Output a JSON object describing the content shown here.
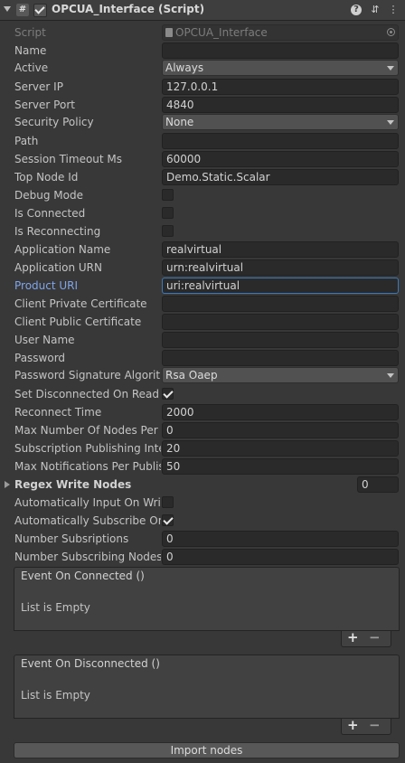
{
  "header": {
    "icon_glyph": "#",
    "title": "OPCUA_Interface (Script)",
    "enabled": true,
    "help_glyph": "?",
    "settings_glyph": "⇵",
    "menu_glyph": "⋮"
  },
  "fields": {
    "script": {
      "label": "Script",
      "value": "OPCUA_Interface"
    },
    "name": {
      "label": "Name",
      "value": ""
    },
    "active": {
      "label": "Active",
      "value": "Always"
    },
    "server_ip": {
      "label": "Server IP",
      "value": "127.0.0.1"
    },
    "server_port": {
      "label": "Server Port",
      "value": "4840"
    },
    "security_policy": {
      "label": "Security Policy",
      "value": "None"
    },
    "path": {
      "label": "Path",
      "value": ""
    },
    "session_timeout": {
      "label": "Session Timeout Ms",
      "value": "60000"
    },
    "top_node_id": {
      "label": "Top Node Id",
      "value": "Demo.Static.Scalar"
    },
    "debug_mode": {
      "label": "Debug Mode",
      "checked": false
    },
    "is_connected": {
      "label": "Is Connected",
      "checked": false
    },
    "is_reconnecting": {
      "label": "Is Reconnecting",
      "checked": false
    },
    "application_name": {
      "label": "Application Name",
      "value": "realvirtual"
    },
    "application_urn": {
      "label": "Application URN",
      "value": "urn:realvirtual"
    },
    "product_uri": {
      "label": "Product URI",
      "value": "uri:realvirtual"
    },
    "client_private_cert": {
      "label": "Client Private Certificate",
      "value": ""
    },
    "client_public_cert": {
      "label": "Client Public Certificate",
      "value": ""
    },
    "user_name": {
      "label": "User Name",
      "value": ""
    },
    "password": {
      "label": "Password",
      "value": ""
    },
    "password_sig_algorithm": {
      "label": "Password Signature Algorithm",
      "value": "Rsa Oaep"
    },
    "set_disconnected_on_read_error": {
      "label": "Set Disconnected On Read Error",
      "checked": true
    },
    "reconnect_time": {
      "label": "Reconnect Time",
      "value": "2000"
    },
    "max_nodes_per_subscription": {
      "label": "Max Number Of Nodes Per Subscription",
      "value": "0"
    },
    "subscription_publishing_interval": {
      "label": "Subscription Publishing Interval",
      "value": "20"
    },
    "max_notifications_per_publish": {
      "label": "Max Notifications Per Publish",
      "value": "50"
    },
    "regex_write_nodes": {
      "label": "Regex Write Nodes",
      "value": "0"
    },
    "auto_input_on_write": {
      "label": "Automatically Input On Write",
      "checked": false
    },
    "auto_subscribe_on_input": {
      "label": "Automatically Subscribe On Input",
      "checked": true
    },
    "number_subscriptions": {
      "label": "Number Subsriptions",
      "value": "0"
    },
    "number_subscribing_nodes": {
      "label": "Number Subscribing Nodes",
      "value": "0"
    }
  },
  "events": {
    "on_connected": {
      "title": "Event On Connected ()",
      "empty_text": "List is Empty",
      "add": "+",
      "remove": "−"
    },
    "on_disconnected": {
      "title": "Event On Disconnected ()",
      "empty_text": "List is Empty",
      "add": "+",
      "remove": "−"
    }
  },
  "import_button": "Import nodes"
}
